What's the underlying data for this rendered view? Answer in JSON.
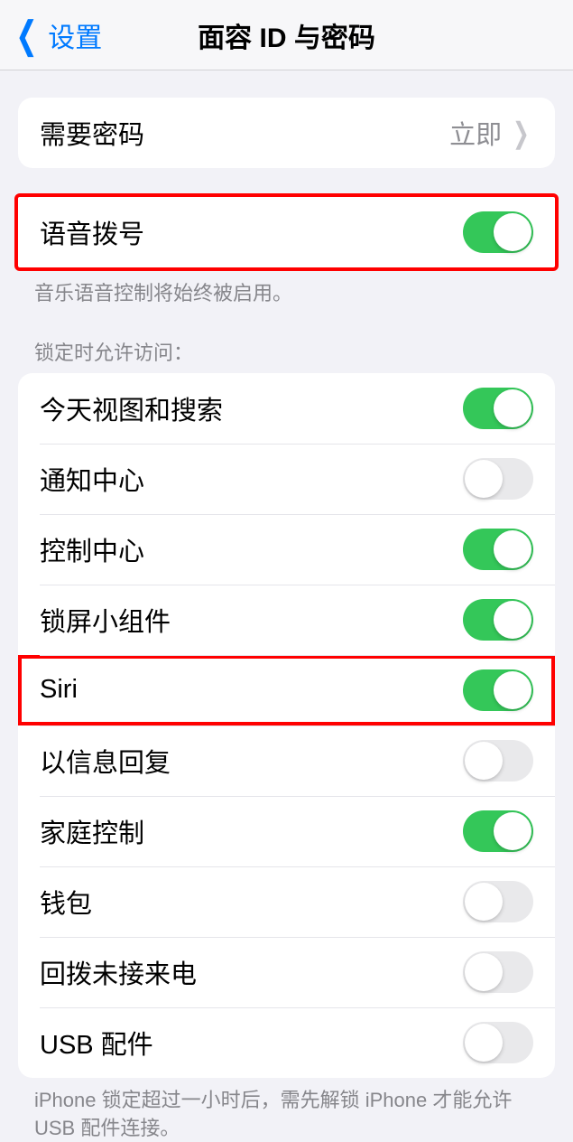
{
  "nav": {
    "back_label": "设置",
    "title": "面容 ID 与密码"
  },
  "require_passcode": {
    "label": "需要密码",
    "value": "立即"
  },
  "voice_dial": {
    "label": "语音拨号",
    "enabled": true,
    "footer": "音乐语音控制将始终被启用。"
  },
  "lock_access": {
    "header": "锁定时允许访问：",
    "items": [
      {
        "label": "今天视图和搜索",
        "enabled": true
      },
      {
        "label": "通知中心",
        "enabled": false
      },
      {
        "label": "控制中心",
        "enabled": true
      },
      {
        "label": "锁屏小组件",
        "enabled": true
      },
      {
        "label": "Siri",
        "enabled": true
      },
      {
        "label": "以信息回复",
        "enabled": false
      },
      {
        "label": "家庭控制",
        "enabled": true
      },
      {
        "label": "钱包",
        "enabled": false
      },
      {
        "label": "回拨未接来电",
        "enabled": false
      },
      {
        "label": "USB 配件",
        "enabled": false
      }
    ],
    "footer": "iPhone 锁定超过一小时后，需先解锁 iPhone 才能允许 USB 配件连接。"
  }
}
